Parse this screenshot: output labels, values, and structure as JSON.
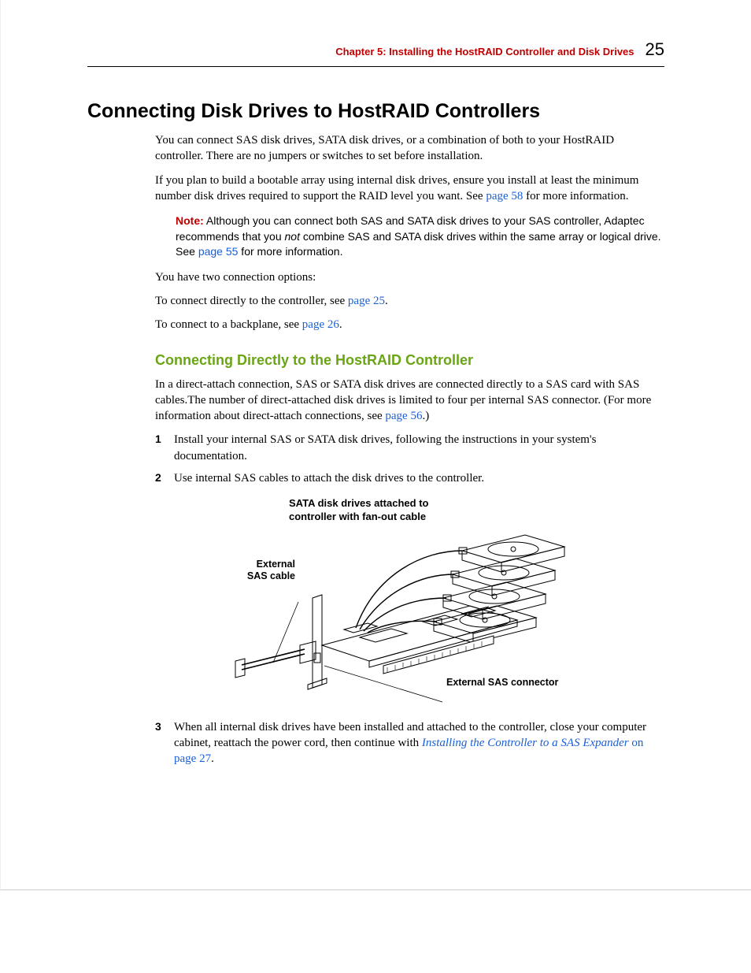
{
  "header": {
    "chapter_label": "Chapter 5: Installing the HostRAID Controller and Disk Drives",
    "page_number": "25"
  },
  "h1": "Connecting Disk Drives to HostRAID Controllers",
  "p1": "You can connect SAS disk drives, SATA disk drives, or a combination of both to your HostRAID controller. There are no jumpers or switches to set before installation.",
  "p2a": "If you plan to build a bootable array using internal disk drives, ensure you install at least the minimum number disk drives required to support the RAID level you want. See ",
  "p2_link": "page 58",
  "p2b": " for more information.",
  "note": {
    "label": "Note:",
    "t1": " Although you can connect both SAS and SATA disk drives to your SAS controller, Adaptec recommends that you ",
    "em": "not",
    "t2": " combine SAS and SATA disk drives within the same array or logical drive. See ",
    "link": "page 55",
    "t3": " for more information."
  },
  "p3": "You have two connection options:",
  "opt1a": "To connect directly to the controller, see ",
  "opt1_link": "page 25",
  "opt1b": ".",
  "opt2a": "To connect to a backplane, see ",
  "opt2_link": "page 26",
  "opt2b": ".",
  "h2": "Connecting Directly to the HostRAID Controller",
  "p4a": "In a direct-attach connection, SAS or SATA disk drives are connected directly to a SAS card with SAS cables.The number of direct-attached disk drives is limited to four per internal SAS connector. (For more information about direct-attach connections, see ",
  "p4_link": "page 56",
  "p4b": ".)",
  "steps": {
    "s1": {
      "num": "1",
      "text": "Install your internal SAS or SATA disk drives, following the instructions in your system's documentation."
    },
    "s2": {
      "num": "2",
      "text": "Use internal SAS cables to attach the disk drives to the controller."
    },
    "s3": {
      "num": "3",
      "t1": "When all internal disk drives have been installed and attached to the controller, close your computer cabinet, reattach the power cord, then continue with ",
      "link1": "Installing the Controller to a SAS Expander",
      "link2": " on page 27",
      "t2": "."
    }
  },
  "figure": {
    "caption_l1": "SATA disk drives attached to",
    "caption_l2": "controller with fan-out cable",
    "label_left_l1": "External",
    "label_left_l2": "SAS cable",
    "label_bottom": "External SAS connector"
  }
}
